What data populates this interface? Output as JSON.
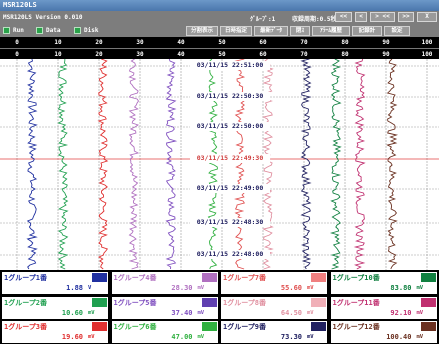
{
  "window": {
    "title": "MSR120LS"
  },
  "topbar": {
    "version": "MSR120LS Version 0.010",
    "group_status": "ｸﾞﾙｰﾌﾟ:1",
    "cycle_status": "収録周期:0.5秒",
    "nav_buttons": [
      "<<",
      "<",
      "> <<",
      ">>",
      "X"
    ],
    "indicators": [
      {
        "label": "Run",
        "color": "#2aa24a"
      },
      {
        "label": "Data",
        "color": "#2aa24a"
      },
      {
        "label": "Disk",
        "color": "#2aa24a"
      }
    ],
    "menu": [
      "分割表示",
      "日時指定",
      "最新ﾃﾞｰﾀ",
      "閉ｽ",
      "ｱﾗｰﾑ履歴",
      "記録計",
      "設定"
    ]
  },
  "scale": {
    "row1": [
      "0",
      "10",
      "20",
      "30",
      "40",
      "50",
      "60",
      "70",
      "80",
      "90",
      "100"
    ],
    "row2": [
      "0",
      "10",
      "20",
      "30",
      "40",
      "50",
      "60",
      "70",
      "80",
      "90",
      "100"
    ]
  },
  "chart": {
    "timestamps": [
      "03/11/15 22:51:00",
      "03/11/15 22:50:30",
      "03/11/15 22:50:00",
      "03/11/15 22:49:30",
      "03/11/15 22:49:00",
      "03/11/15 22:48:30",
      "03/11/15 22:48:00"
    ],
    "highlight_timestamp_index": 3
  },
  "panels": [
    {
      "title": "1グループ1番",
      "value": "1.88",
      "unit": "V",
      "title_color": "#2030a0",
      "swatch": "#2030a0"
    },
    {
      "title": "1グループ4番",
      "value": "28.30",
      "unit": "mV",
      "title_color": "#b070c0",
      "swatch": "#b070c0"
    },
    {
      "title": "1グループ7番",
      "value": "55.60",
      "unit": "mV",
      "title_color": "#e05050",
      "swatch": "#f08080"
    },
    {
      "title": "1グループ10番",
      "value": "83.80",
      "unit": "mV",
      "title_color": "#108040",
      "swatch": "#108040"
    },
    {
      "title": "1グループ2番",
      "value": "10.60",
      "unit": "mV",
      "title_color": "#20a050",
      "swatch": "#20a050"
    },
    {
      "title": "1グループ5番",
      "value": "37.40",
      "unit": "mV",
      "title_color": "#8050c0",
      "swatch": "#6040b0"
    },
    {
      "title": "1グループ8番",
      "value": "64.50",
      "unit": "mV",
      "title_color": "#e090a0",
      "swatch": "#f0b0b8"
    },
    {
      "title": "1グループ11番",
      "value": "92.10",
      "unit": "mV",
      "title_color": "#c03070",
      "swatch": "#c03070"
    },
    {
      "title": "1グループ3番",
      "value": "19.60",
      "unit": "mV",
      "title_color": "#e03030",
      "swatch": "#e03030"
    },
    {
      "title": "1グループ6番",
      "value": "47.00",
      "unit": "mV",
      "title_color": "#30b040",
      "swatch": "#30b040"
    },
    {
      "title": "1グループ9番",
      "value": "73.30",
      "unit": "mV",
      "title_color": "#202060",
      "swatch": "#202060"
    },
    {
      "title": "1グループ12番",
      "value": "100.40",
      "unit": "mV",
      "title_color": "#6a3020",
      "swatch": "#6a3020"
    }
  ]
}
